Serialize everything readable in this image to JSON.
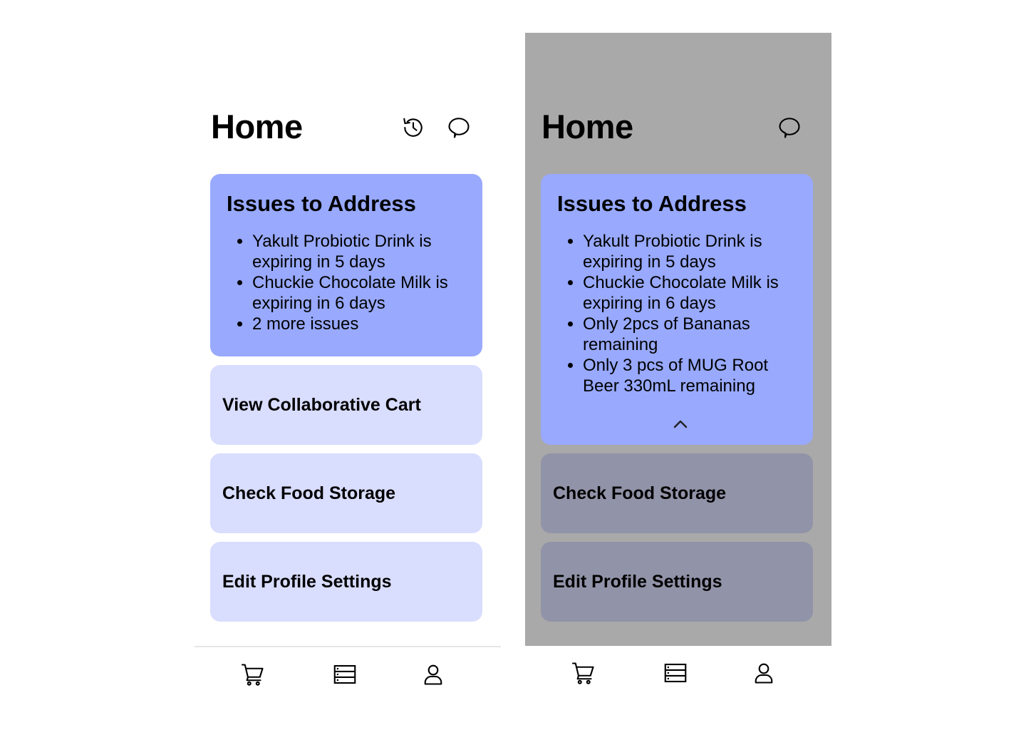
{
  "screens": [
    {
      "id": "home-default",
      "title": "Home",
      "header_icons": [
        "history-icon",
        "chat-icon"
      ],
      "issues": {
        "title": "Issues to Address",
        "items": [
          "Yakult Probiotic Drink is expiring in 5 days",
          "Chuckie Chocolate Milk is expiring in 6 days",
          "2 more issues"
        ]
      },
      "actions": [
        "View Collaborative Cart",
        "Check Food Storage",
        "Edit Profile Settings"
      ],
      "nav": [
        "cart-icon",
        "storage-icon",
        "profile-icon"
      ]
    },
    {
      "id": "home-issues-expanded",
      "title": "Home",
      "header_icons": [
        "chat-icon"
      ],
      "issues": {
        "title": "Issues to Address",
        "items": [
          "Yakult Probiotic Drink is expiring in 5 days",
          "Chuckie Chocolate Milk is expiring in 6 days",
          "Only 2pcs of Bananas remaining",
          "Only 3 pcs of MUG Root Beer 330mL remaining"
        ],
        "collapse_icon": "chevron-up-icon"
      },
      "actions": [
        "Check Food Storage",
        "Edit Profile Settings"
      ],
      "nav": [
        "cart-icon",
        "storage-icon",
        "profile-icon"
      ]
    }
  ],
  "colors": {
    "issues_card": "#98a9fe",
    "action_card": "#d9ddfe",
    "action_card_dimmed": "#9193a8",
    "overlay": "#a9a9a9"
  }
}
